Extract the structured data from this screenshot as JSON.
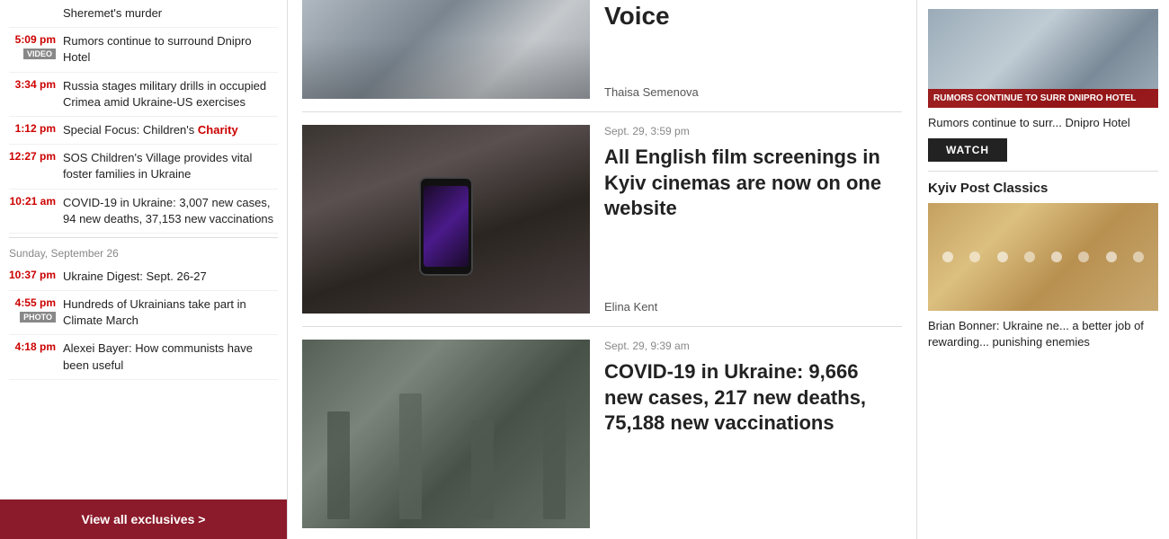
{
  "sidebar": {
    "items": [
      {
        "time": "",
        "badge": null,
        "title": "Sheremet's murder",
        "titleParts": [
          {
            "text": "Sheremet's murder",
            "highlight": false
          }
        ]
      },
      {
        "time": "5:09 pm",
        "badge": "VIDEO",
        "title": "Rumors continue to surround Dnipro Hotel",
        "titleParts": [
          {
            "text": "Rumors continue to surround Dnipro Hotel",
            "highlight": false
          }
        ]
      },
      {
        "time": "3:34 pm",
        "badge": null,
        "title": "Russia stages military drills in occupied Crimea amid Ukraine-US exercises",
        "titleParts": [
          {
            "text": "Russia stages military drills in occupied Crimea amid Ukraine-US exercises",
            "highlight": false
          }
        ]
      },
      {
        "time": "1:12 pm",
        "badge": null,
        "title": "Special Focus: Children's Charity",
        "titleParts": [
          {
            "text": "Special Focus: Children's ",
            "highlight": false
          },
          {
            "text": "Charity",
            "highlight": true
          }
        ]
      },
      {
        "time": "12:27 pm",
        "badge": null,
        "title": "SOS Children's Village provides vital foster families in Ukraine",
        "titleParts": [
          {
            "text": "SOS Children's Village provides vital foster families in Ukraine",
            "highlight": false
          }
        ]
      },
      {
        "time": "10:21 am",
        "badge": null,
        "title": "COVID-19 in Ukraine: 3,007 new cases, 94 new deaths, 37,153 new vaccinations",
        "titleParts": [
          {
            "text": "COVID-19 in Ukraine: 3,007 new cases, 94 new deaths, 37,153 new vaccinations",
            "highlight": false
          }
        ]
      }
    ],
    "date_separator": "Sunday, September 26",
    "items2": [
      {
        "time": "10:37 pm",
        "badge": null,
        "title": "Ukraine Digest: Sept. 26-27"
      },
      {
        "time": "4:55 pm",
        "badge": "PHOTO",
        "title": "Hundreds of Ukrainians take part in Climate March"
      },
      {
        "time": "4:18 pm",
        "badge": null,
        "title": "Alexei Bayer: How communists have been useful"
      }
    ],
    "view_all_label": "View all exclusives >"
  },
  "articles": [
    {
      "date": "",
      "title": "Voice",
      "author": "Thaisa Semenova",
      "imgType": "mask"
    },
    {
      "date": "Sept. 29, 3:59 pm",
      "title": "All English film screenings in Kyiv cinemas are now on one website",
      "author": "Elina Kent",
      "imgType": "phone"
    },
    {
      "date": "Sept. 29, 9:39 am",
      "title": "COVID-19 in Ukraine: 9,666 new cases, 217 new deaths, 75,188 new vaccinations",
      "author": "",
      "imgType": "metro"
    }
  ],
  "right_sidebar": {
    "news_item": {
      "overlay_text": "RUMORS CONTINUE TO SURR DNIPRO HOTEL",
      "text": "Rumors continue to surr... Dnipro Hotel",
      "watch_label": "WATCH"
    },
    "classics": {
      "title": "Kyiv Post Classics",
      "text": "Brian Bonner: Ukraine ne... a better job of rewarding... punishing enemies"
    }
  }
}
